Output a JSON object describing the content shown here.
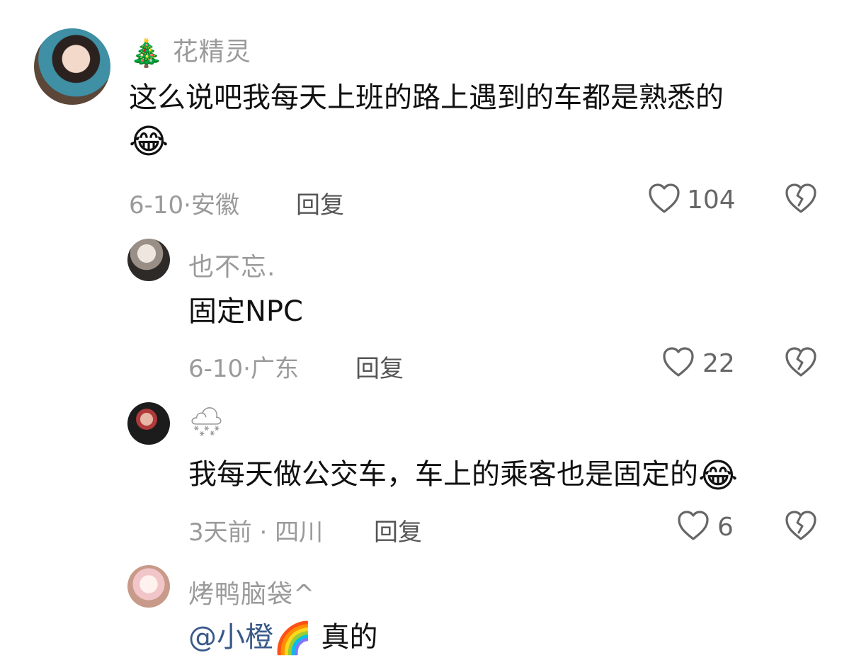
{
  "comments": [
    {
      "username_emoji": "🎄",
      "username": "花精灵",
      "text": "这么说吧我每天上班的路上遇到的车都是熟悉的",
      "text_emoji": "😂",
      "date": "6-10",
      "location": "安徽",
      "reply_label": "回复",
      "likes": "104"
    },
    {
      "username": "也不忘.",
      "text": "固定NPC",
      "date": "6-10",
      "location": "广东",
      "reply_label": "回复",
      "likes": "22"
    },
    {
      "username_emoji": "🌨",
      "username": "",
      "text": "我每天做公交车，车上的乘客也是固定的",
      "text_emoji": "😂",
      "date": "3天前",
      "location": "四川",
      "reply_label": "回复",
      "likes": "6"
    },
    {
      "username": "烤鸭脑袋^",
      "mention": "@小橙",
      "mention_emoji": "🌈",
      "text": "真的"
    }
  ],
  "icons": {
    "like": "heart-outline-icon",
    "dislike": "broken-heart-icon"
  }
}
